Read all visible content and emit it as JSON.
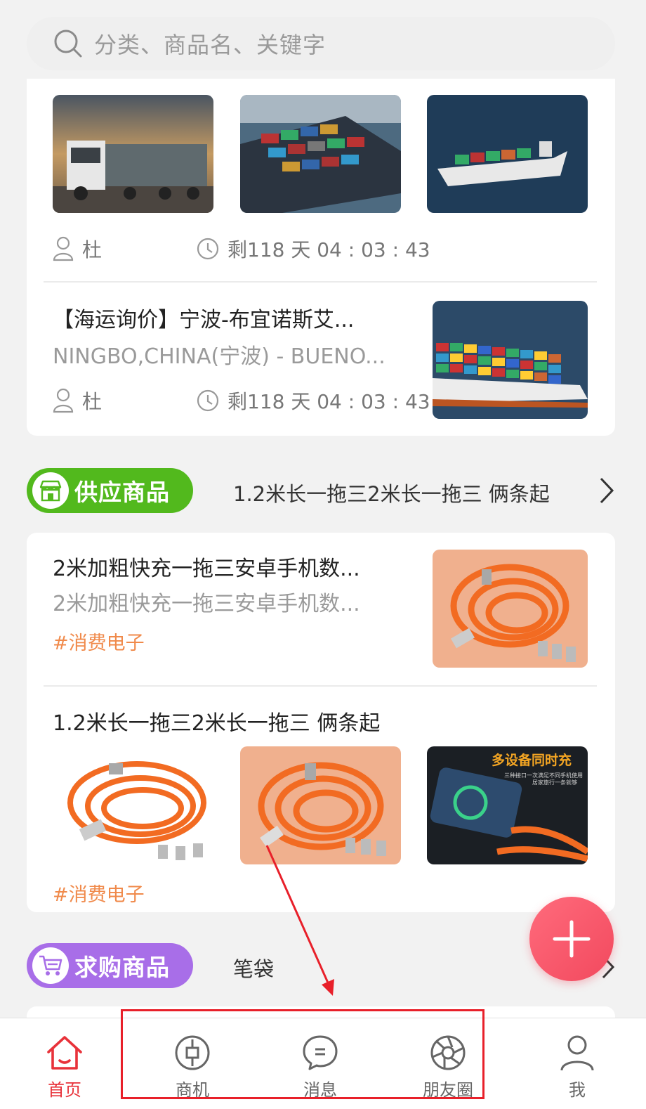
{
  "search": {
    "placeholder": "分类、商品名、关键字"
  },
  "logistics": {
    "first": {
      "user": "杜",
      "countdown": "剩118 天 04 : 03 : 43"
    },
    "second": {
      "title": "【海运询价】宁波-布宜诺斯艾...",
      "subtitle": "NINGBO,CHINA(宁波) - BUENO...",
      "user": "杜",
      "countdown": "剩118 天 04 : 03 : 43"
    }
  },
  "supply": {
    "label": "供应商品",
    "ticker": "1.2米长一拖三2米长一拖三 俩条起",
    "items": [
      {
        "title": "2米加粗快充一拖三安卓手机数...",
        "subtitle": "2米加粗快充一拖三安卓手机数...",
        "tag": "#消费电子"
      },
      {
        "title": "1.2米长一拖三2米长一拖三 俩条起",
        "tag": "#消费电子",
        "image_caption": "多设备同时充",
        "image_small_text_1": "三种接口一次满足不同手机使用",
        "image_small_text_2": "居家旅行一条就够"
      }
    ]
  },
  "purchase": {
    "label": "求购商品",
    "ticker": "笔袋"
  },
  "nav": {
    "items": [
      {
        "label": "首页",
        "icon": "home-icon",
        "active": true
      },
      {
        "label": "商机",
        "icon": "business-icon"
      },
      {
        "label": "消息",
        "icon": "message-icon"
      },
      {
        "label": "朋友圈",
        "icon": "moments-icon"
      },
      {
        "label": "我",
        "icon": "profile-icon"
      }
    ]
  },
  "colors": {
    "accent": "#e8323a",
    "supply_green": "#52b91d",
    "purchase_purple": "#a86ee8",
    "tag_orange": "#f08a4b",
    "fab": "#f2495e"
  }
}
